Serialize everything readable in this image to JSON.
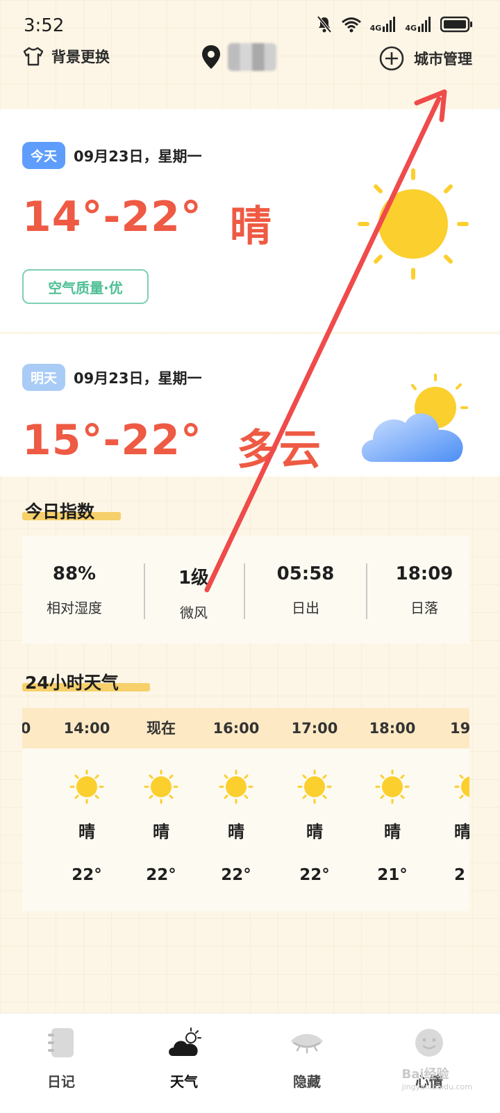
{
  "status_bar": {
    "time": "3:52",
    "net1": "4G",
    "net2": "4G"
  },
  "topbar": {
    "bg_change": "背景更换",
    "city_manage": "城市管理"
  },
  "today": {
    "badge": "今天",
    "date": "09月23日，星期一",
    "temp_range": "14°-22°",
    "condition": "晴",
    "aqi": "空气质量·优",
    "icon": "sun-icon"
  },
  "tomorrow": {
    "badge": "明天",
    "date": "09月23日，星期一",
    "temp_range": "15°-22°",
    "condition": "多云",
    "icon": "partly-cloudy-icon"
  },
  "index": {
    "title": "今日指数",
    "items": [
      {
        "value": "88%",
        "label": "相对湿度"
      },
      {
        "value": "1级",
        "label": "微风"
      },
      {
        "value": "05:58",
        "label": "日出"
      },
      {
        "value": "18:09",
        "label": "日落"
      }
    ]
  },
  "hourly": {
    "title": "24小时天气",
    "items": [
      {
        "time": "0",
        "cond": "",
        "temp": ""
      },
      {
        "time": "14:00",
        "cond": "晴",
        "temp": "22°"
      },
      {
        "time": "现在",
        "cond": "晴",
        "temp": "22°"
      },
      {
        "time": "16:00",
        "cond": "晴",
        "temp": "22°"
      },
      {
        "time": "17:00",
        "cond": "晴",
        "temp": "22°"
      },
      {
        "time": "18:00",
        "cond": "晴",
        "temp": "21°"
      },
      {
        "time": "19:",
        "cond": "晴",
        "temp": "2"
      }
    ]
  },
  "nav": {
    "diary": "日记",
    "weather": "天气",
    "hidden": "隐藏",
    "mood": "心情"
  },
  "watermark": {
    "brand": "Bai经验",
    "url": "jingyan.baidu.com"
  },
  "colors": {
    "accent_red": "#ee5a43",
    "today_badge": "#5e9dfb",
    "tomorrow_badge": "#a9ccf7",
    "aqi_green": "#4fbf95",
    "highlight": "#f6d06a",
    "sun": "#fbcf2e"
  }
}
